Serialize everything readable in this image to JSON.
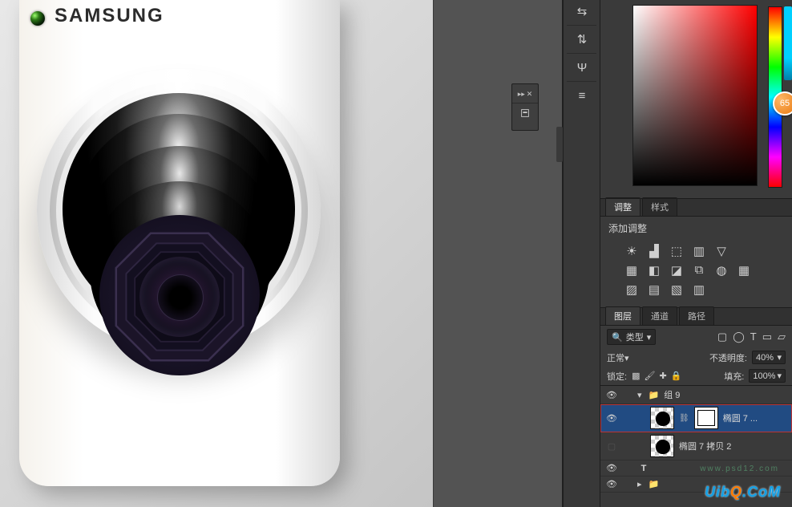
{
  "brand_text": "SAMSUNG",
  "badge_value": "65",
  "adjust_tabs": {
    "t1": "调整",
    "t2": "样式"
  },
  "adjust_label": "添加调整",
  "layers_tabs": {
    "t1": "图层",
    "t2": "通道",
    "t3": "路径"
  },
  "filter": {
    "label": "类型"
  },
  "blend": {
    "mode": "正常",
    "opacity_label": "不透明度:",
    "opacity_value": "40%"
  },
  "lock": {
    "label": "锁定:",
    "fill_label": "填充:",
    "fill_value": "100%"
  },
  "layers": {
    "group": "组 9",
    "ellipse7": "椭圆 7 ...",
    "ellipse7copy2": "椭圆 7 拷贝 2"
  },
  "watermark": {
    "pre": "Uib",
    "o": "Q",
    "post": ".CoM",
    "sub": "www.psd12.com"
  },
  "icons": {
    "collapse": "▸▸",
    "close": "✕",
    "settings": "settings-icon",
    "tb_a": "⇆",
    "tb_b": "⇅",
    "tb_c": "Ψ",
    "tb_d": "≡",
    "sun": "☀",
    "contrast": "◐",
    "levels": "▟",
    "curves": "⬚",
    "exposure": "▥",
    "vibrance": "▽",
    "hue": "▦",
    "bw": "◧",
    "photo": "◪",
    "mixer": "⧉",
    "lut": "◍",
    "grid": "▦",
    "invert": "▨",
    "poster": "▤",
    "thresh": "▧",
    "grad": "▥",
    "li_img": "▢",
    "li_fx": "◯",
    "li_t": "T",
    "li_shape": "▭",
    "li_smart": "▱",
    "eye": "👁",
    "folder": "📁",
    "arrow_down": "▾",
    "arrow_right": "▸",
    "link": "⛓",
    "search": "🔍",
    "dd": "▾",
    "lock": "🔒",
    "brush": "🖌",
    "plus": "✚",
    "pix": "▩"
  }
}
